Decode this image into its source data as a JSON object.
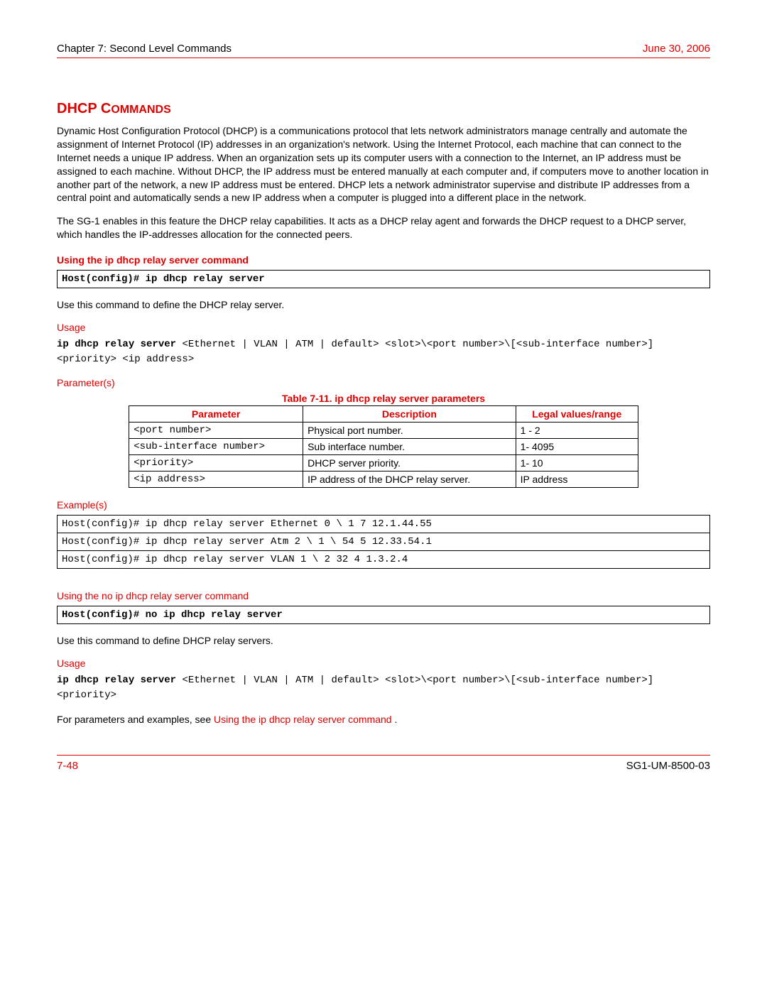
{
  "header": {
    "chapter": "Chapter 7: Second Level Commands",
    "date": "June 30, 2006"
  },
  "section_title": "DHCP Commands",
  "intro_p1": "Dynamic Host Configuration Protocol (DHCP) is a communications protocol that lets network administrators manage centrally and automate the assignment of Internet Protocol (IP) addresses in an organization's network. Using the Internet Protocol, each machine that can connect to the Internet needs a unique IP address. When an organization sets up its computer users with a connection to the Internet, an IP address must be assigned to each machine. Without DHCP, the IP address must be entered manually at each computer and, if computers move to another location in another part of the network, a new IP address must be entered. DHCP lets a network administrator supervise and distribute IP addresses from a central point and automatically sends a new IP address when a computer is plugged into a different place in the network.",
  "intro_p2": "The SG-1 enables in this feature the DHCP relay capabilities. It acts as a DHCP relay agent and forwards the DHCP request to a DHCP server, which handles the IP-addresses allocation for the connected peers.",
  "cmd1": {
    "heading": "Using the ip dhcp relay server command",
    "box": "Host(config)# ip dhcp relay server",
    "desc": "Use this command to define the DHCP relay server.",
    "usage_label": "Usage",
    "usage_lead": "ip dhcp relay server ",
    "usage_rest": "<Ethernet | VLAN | ATM | default> <slot>\\<port number>\\[<sub-interface number>] <priority> <ip address>",
    "params_label": "Parameter(s)",
    "table_caption": "Table 7-11. ip dhcp relay server parameters",
    "table_headers": {
      "p": "Parameter",
      "d": "Description",
      "v": "Legal values/range"
    },
    "rows": [
      {
        "p": "<port number>",
        "d": "Physical port number.",
        "v": "1 - 2"
      },
      {
        "p": "<sub-interface number>",
        "d": "Sub interface number.",
        "v": "1- 4095"
      },
      {
        "p": "<priority>",
        "d": "DHCP server priority.",
        "v": "1- 10"
      },
      {
        "p": "<ip address>",
        "d": "IP address of the DHCP relay server.",
        "v": "IP address"
      }
    ],
    "examples_label": "Example(s)",
    "examples": [
      "Host(config)# ip dhcp relay server Ethernet 0 \\ 1 7 12.1.44.55",
      "Host(config)# ip dhcp relay server Atm 2 \\ 1 \\ 54 5 12.33.54.1",
      "Host(config)# ip dhcp relay server VLAN 1 \\ 2 32 4 1.3.2.4"
    ]
  },
  "cmd2": {
    "heading": "Using the no ip dhcp relay server command",
    "box": "Host(config)# no ip dhcp relay server",
    "desc": "Use this command to define DHCP relay servers.",
    "usage_label": "Usage",
    "usage_lead": "ip dhcp relay server ",
    "usage_rest": "<Ethernet | VLAN | ATM | default> <slot>\\<port number>\\[<sub-interface number>] <priority>",
    "xref_pre": "For parameters and examples, see  ",
    "xref_link": "Using the ip dhcp relay server command",
    "xref_post": " ."
  },
  "footer": {
    "page": "7-48",
    "doc": "SG1-UM-8500-03"
  }
}
